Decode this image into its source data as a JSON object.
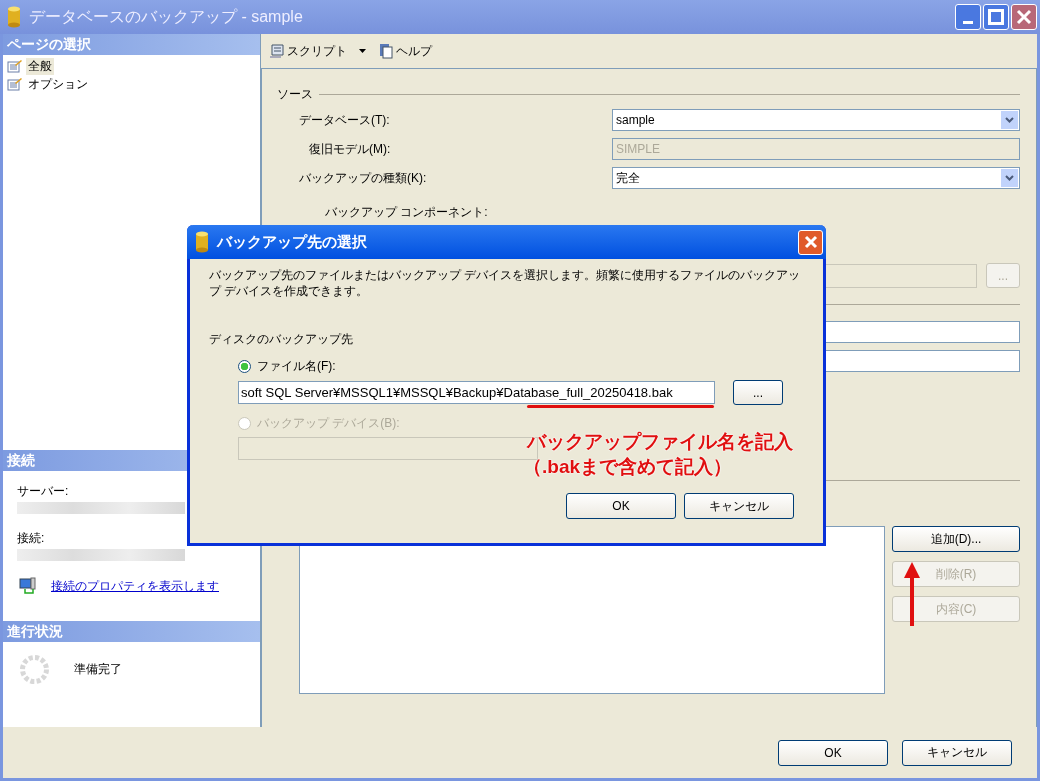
{
  "window": {
    "title": "データベースのバックアップ - sample"
  },
  "page_select": {
    "header": "ページの選択",
    "items": [
      {
        "label": "全般",
        "selected": true
      },
      {
        "label": "オプション",
        "selected": false
      }
    ]
  },
  "connection": {
    "header": "接続",
    "server_label": "サーバー:",
    "connection_label": "接続:",
    "link": "接続のプロパティを表示します"
  },
  "progress": {
    "header": "進行状況",
    "status": "準備完了"
  },
  "toolbar": {
    "script": "スクリプト",
    "help": "ヘルプ"
  },
  "source": {
    "legend": "ソース",
    "fields": [
      {
        "label": "データベース(T):",
        "value": "sample",
        "kind": "dropdown"
      },
      {
        "label": "復旧モデル(M):",
        "value": "SIMPLE",
        "kind": "readonly"
      },
      {
        "label": "バックアップの種類(K):",
        "value": "完全",
        "kind": "dropdown"
      }
    ],
    "component_label": "バックアップ コンポーネント:"
  },
  "destination": {
    "browse_button": "...",
    "buttons": [
      {
        "label": "追加(D)...",
        "disabled": false
      },
      {
        "label": "削除(R)",
        "disabled": true
      },
      {
        "label": "内容(C)",
        "disabled": true
      }
    ]
  },
  "buttons": [
    "OK",
    "キャンセル"
  ],
  "dialog": {
    "title": "バックアップ先の選択",
    "description": "バックアップ先のファイルまたはバックアップ デバイスを選択します。頻繁に使用するファイルのバックアップ デバイスを作成できます。",
    "group_label": "ディスクのバックアップ先",
    "options": [
      {
        "label": "ファイル名(F):",
        "selected": true,
        "disabled": false,
        "value": "soft SQL Server¥MSSQL1¥MSSQL¥Backup¥Database_full_20250418.bak",
        "browse": "..."
      },
      {
        "label": "バックアップ デバイス(B):",
        "selected": false,
        "disabled": true
      }
    ],
    "buttons": [
      "OK",
      "キャンセル"
    ]
  },
  "annotation": {
    "lines": [
      "バックアップファイル名を記入",
      "（.bakまで含めて記入）"
    ]
  }
}
